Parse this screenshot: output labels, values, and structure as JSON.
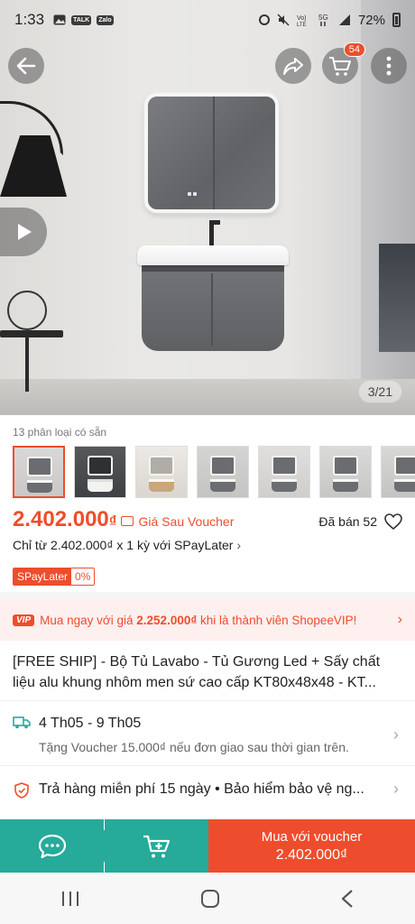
{
  "status_bar": {
    "time": "1:33",
    "notification_icons": [
      "image-icon",
      "talk-icon",
      "zalo-icon"
    ],
    "notification_labels": [
      "TALK",
      "Zalo"
    ],
    "right_icons": [
      "alarm-icon",
      "mute-icon",
      "volte-icon",
      "5g-icon",
      "signal-icon"
    ],
    "battery": "72%"
  },
  "header": {
    "back_icon": "arrow-left-icon",
    "share_icon": "share-icon",
    "cart_icon": "cart-icon",
    "cart_count": "54",
    "more_icon": "more-vertical-icon"
  },
  "gallery": {
    "counter": "3/21",
    "video_icon": "play-icon"
  },
  "variants": {
    "label": "13 phân loại có sẵn",
    "thumbnails": [
      "variant-1",
      "variant-2",
      "variant-3",
      "variant-4",
      "variant-5",
      "variant-6",
      "variant-7"
    ],
    "selected_index": 0
  },
  "price": {
    "value": "2.402.000",
    "currency": "₫",
    "voucher_label": "Giá Sau Voucher",
    "sold": "Đã bán 52"
  },
  "paylater": {
    "line": "Chỉ từ 2.402.000₫ x 1 kỳ với SPayLater",
    "badge_name": "SPayLater",
    "badge_rate": "0%"
  },
  "vip": {
    "badge": "VIP",
    "text_before": "Mua ngay với giá ",
    "price": "2.252.000₫",
    "text_after": " khi là thành viên ShopeeVIP!"
  },
  "product": {
    "title": "[FREE SHIP] - Bộ Tủ Lavabo - Tủ Gương Led + Sấy chất liệu alu khung nhôm men sứ cao cấp KT80x48x48 - KT..."
  },
  "shipping": {
    "dates": "4 Th05 - 9 Th05",
    "note": "Tặng Voucher 15.000₫ nếu đơn giao sau thời gian trên."
  },
  "returns": {
    "text": "Trả hàng miễn phí 15 ngày  •  Bảo hiểm bảo vệ ng..."
  },
  "bottom_bar": {
    "chat_icon": "chat-icon",
    "add_cart_icon": "add-to-cart-icon",
    "buy_label": "Mua với voucher",
    "buy_price": "2.402.000₫"
  },
  "nav": {
    "items": [
      "recent-apps-icon",
      "home-icon",
      "back-icon"
    ]
  },
  "colors": {
    "accent": "#ee4d2d",
    "teal": "#26aa99"
  }
}
